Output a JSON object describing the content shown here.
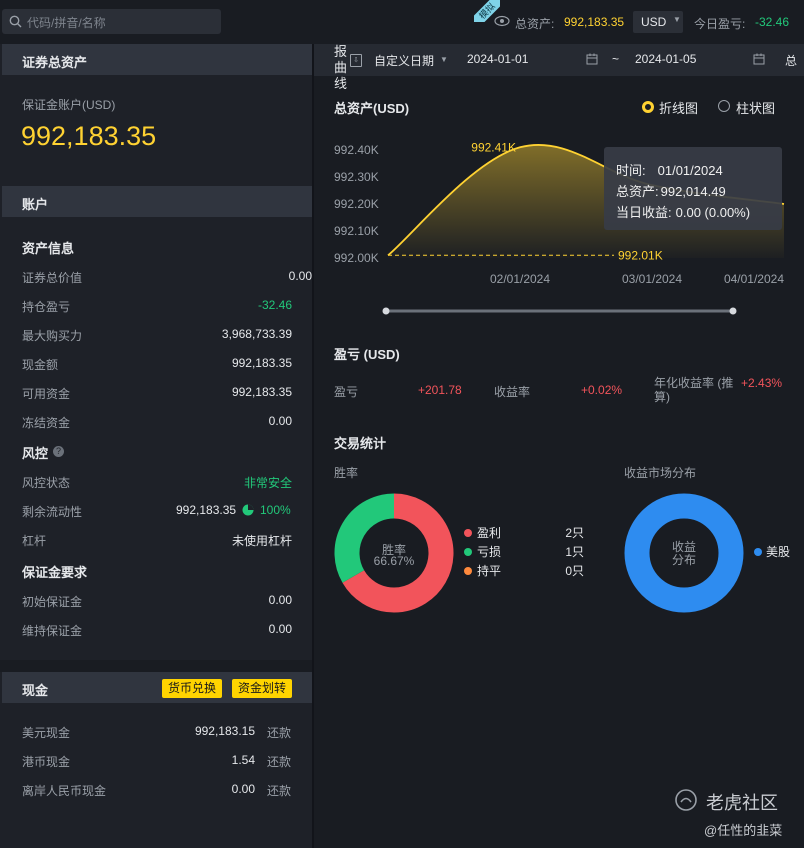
{
  "search": {
    "placeholder": "代码/拼音/名称"
  },
  "topbar": {
    "demo_badge": "模拟",
    "total_assets_label": "总资产:",
    "total_assets_value": "992,183.35",
    "currency": "USD",
    "today_pnl_label": "今日盈亏:",
    "today_pnl_value": "-32.46"
  },
  "securities_panel": {
    "title": "证券总资产",
    "account_label": "保证金账户(USD)",
    "total": "992,183.35"
  },
  "account_panel": {
    "title": "账户",
    "asset_info_title": "资产信息",
    "asset_rows": [
      {
        "label": "证券总价值",
        "value": "0.00"
      },
      {
        "label": "持仓盈亏",
        "value": "-32.46"
      },
      {
        "label": "最大购买力",
        "value": "3,968,733.39"
      },
      {
        "label": "现金额",
        "value": "992,183.35"
      },
      {
        "label": "可用资金",
        "value": "992,183.35"
      },
      {
        "label": "冻结资金",
        "value": "0.00"
      }
    ],
    "risk_title": "风控",
    "risk_rows": [
      {
        "label": "风控状态",
        "value": "非常安全"
      },
      {
        "label": "剩余流动性",
        "value": "992,183.35",
        "pct": "100%"
      },
      {
        "label": "杠杆",
        "value": "未使用杠杆"
      }
    ],
    "margin_title": "保证金要求",
    "margin_rows": [
      {
        "label": "初始保证金",
        "value": "0.00"
      },
      {
        "label": "维持保证金",
        "value": "0.00"
      }
    ]
  },
  "cash_panel": {
    "title": "现金",
    "btn_exchange": "货币兑换",
    "btn_transfer": "资金划转",
    "rows": [
      {
        "label": "美元现金",
        "value": "992,183.15",
        "action": "还款"
      },
      {
        "label": "港币现金",
        "value": "1.54",
        "action": "还款"
      },
      {
        "label": "离岸人民币现金",
        "value": "0.00",
        "action": "还款"
      }
    ]
  },
  "report": {
    "title": "报曲线",
    "date_mode": "自定义日期",
    "start_date": "2024-01-01",
    "separator": "~",
    "end_date": "2024-01-05",
    "overflow": "总"
  },
  "asset_chart": {
    "title": "总资产(USD)",
    "opt_line": "折线图",
    "opt_bar": "柱状图",
    "tooltip": {
      "time_label": "时间:",
      "time_value": "01/01/2024",
      "assets_label": "总资产:",
      "assets_value": "992,014.49",
      "pnl_label": "当日收益:",
      "pnl_value": "0.00 (0.00%)"
    }
  },
  "chart_data": {
    "type": "area",
    "title": "总资产(USD)",
    "x": [
      "01/01/2024",
      "02/01/2024",
      "03/01/2024",
      "04/01/2024"
    ],
    "series": [
      {
        "values": [
          992.01,
          992.41,
          992.27,
          992.2
        ]
      }
    ],
    "y_unit": "K",
    "y_ticks": [
      "992.00K",
      "992.10K",
      "992.20K",
      "992.30K",
      "992.40K"
    ],
    "x_ticks": [
      "02/01/2024",
      "03/01/2024",
      "04/01/2024"
    ],
    "ylim": [
      992.0,
      992.4
    ],
    "max_label": "992.41K",
    "min_label": "992.01K",
    "color": "#ffd232"
  },
  "pnl": {
    "title": "盈亏 (USD)",
    "pnl_label": "盈亏",
    "pnl_value": "+201.78",
    "rate_label": "收益率",
    "rate_value": "+0.02%",
    "annual_label": "年化收益率 (推算)",
    "annual_value": "+2.43%"
  },
  "trade_stats": {
    "title": "交易统计",
    "winrate_title": "胜率",
    "market_title": "收益市场分布",
    "donut_center": "胜率",
    "donut_pct": "66.67%",
    "legend": [
      {
        "label": "盈利",
        "count": "2只",
        "color": "#f2545b"
      },
      {
        "label": "亏损",
        "count": "1只",
        "color": "#22c87a"
      },
      {
        "label": "持平",
        "count": "0只",
        "color": "#ff8a3d"
      }
    ],
    "market_center": "收益分布",
    "market_legend": "美股",
    "market_color": "#2e8cf0"
  },
  "watermark": {
    "brand": "老虎社区",
    "user": "@任性的韭菜"
  }
}
